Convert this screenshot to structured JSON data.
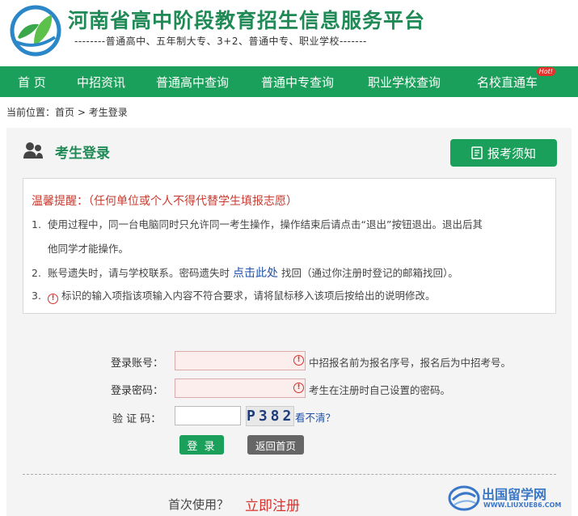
{
  "header": {
    "title": "河南省高中阶段教育招生信息服务平台",
    "subtitle": "--------普通高中、五年制大专、3+2、普通中专、职业学校-------"
  },
  "nav": {
    "items": [
      {
        "label": "首 页"
      },
      {
        "label": "中招资讯"
      },
      {
        "label": "普通高中查询"
      },
      {
        "label": "普通中专查询"
      },
      {
        "label": "职业学校查询"
      },
      {
        "label": "名校直通车"
      }
    ],
    "hot_badge": "Hot!"
  },
  "breadcrumb": {
    "prefix": "当前位置：",
    "home": "首页",
    "separator": " > ",
    "current": "考生登录"
  },
  "panel": {
    "title": "考生登录",
    "notice_button": "报考须知"
  },
  "tips": {
    "title": "温馨提醒：（任何单位或个人不得代替学生填报志愿）",
    "line1_num": "1.",
    "line1": "使用过程中，同一台电脑同时只允许同一考生操作，操作结束后请点击“退出”按钮退出。退出后其",
    "line1b": "他同学才能操作。",
    "line2_num": "2.",
    "line2_a": "账号遗失时，请与学校联系。密码遗失时 ",
    "line2_link": "点击此处",
    "line2_b": " 找回（通过你注册时登记的邮箱找回）。",
    "line3_num": "3.",
    "line3": "标识的输入项指该项输入内容不符合要求，请将鼠标移入该项后按给出的说明修改。"
  },
  "form": {
    "account_label": "登录账号：",
    "account_value": "",
    "account_hint": "中招报名前为报名序号，报名后为中招考号。",
    "password_label": "登录密码：",
    "password_value": "",
    "password_hint": "考生在注册时自己设置的密码。",
    "captcha_label": "验 证 码：",
    "captcha_value": "",
    "captcha_image_text": "P382",
    "captcha_refresh": "看不清？",
    "login_button": "登 录",
    "home_button": "返回首页"
  },
  "footer": {
    "first_use": "首次使用？",
    "register": "立即注册"
  },
  "watermark": {
    "text": "出国留学网",
    "url": "WWW.LIUXUE86.COM"
  },
  "colors": {
    "brand_green": "#1aa05a",
    "title_green": "#1f8a55",
    "warning_red": "#d9312b",
    "link_blue": "#1f4fa8"
  }
}
